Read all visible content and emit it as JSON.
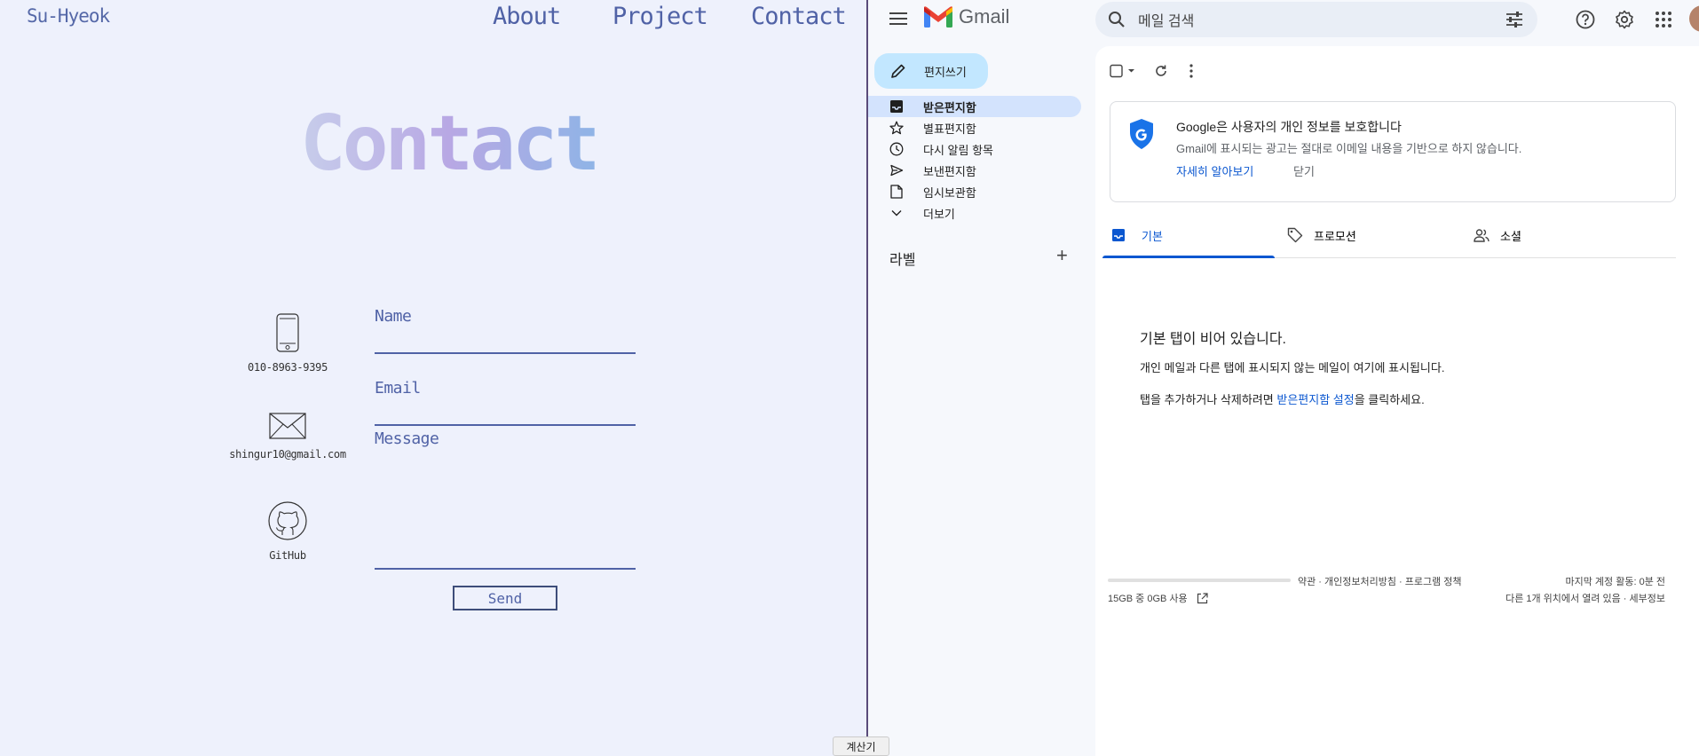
{
  "portfolio": {
    "brand": "Su-Hyeok",
    "nav": [
      "About",
      "Project",
      "Contact"
    ],
    "hero": "Contact",
    "contacts": [
      {
        "icon": "phone-icon",
        "caption": "010-8963-9395"
      },
      {
        "icon": "mail-icon",
        "caption": "shingur10@gmail.com"
      },
      {
        "icon": "github-icon",
        "caption": "GitHub"
      }
    ],
    "form": {
      "name_label": "Name",
      "email_label": "Email",
      "message_label": "Message",
      "send_label": "Send"
    },
    "taskbar_tip": "계산기"
  },
  "gmail": {
    "logo": "Gmail",
    "search_placeholder": "메일 검색",
    "compose": "편지쓰기",
    "nav": [
      {
        "label": "받은편지함",
        "icon": "inbox-icon",
        "active": true
      },
      {
        "label": "별표편지함",
        "icon": "star-icon",
        "active": false
      },
      {
        "label": "다시 알림 항목",
        "icon": "clock-icon",
        "active": false
      },
      {
        "label": "보낸편지함",
        "icon": "send-icon",
        "active": false
      },
      {
        "label": "임시보관함",
        "icon": "draft-icon",
        "active": false
      },
      {
        "label": "더보기",
        "icon": "chevron-down-icon",
        "active": false
      }
    ],
    "labels_heading": "라벨",
    "privacy": {
      "title": "Google은 사용자의 개인 정보를 보호합니다",
      "description": "Gmail에 표시되는 광고는 절대로 이메일 내용을 기반으로 하지 않습니다.",
      "learn_more": "자세히 알아보기",
      "dismiss": "닫기"
    },
    "tabs": [
      {
        "label": "기본",
        "icon": "inbox-icon",
        "active": true
      },
      {
        "label": "프로모션",
        "icon": "tag-icon",
        "active": false
      },
      {
        "label": "소셜",
        "icon": "people-icon",
        "active": false
      }
    ],
    "empty": {
      "title": "기본 탭이 비어 있습니다.",
      "description": "개인 메일과 다른 탭에 표시되지 않는 메일이 여기에 표시됩니다.",
      "hint_prefix": "탭을 추가하거나 삭제하려면 ",
      "hint_link": "받은편지함 설정",
      "hint_suffix": "을 클릭하세요."
    },
    "footer": {
      "storage": "15GB 중 0GB 사용",
      "storage_used_fraction": 0,
      "links": "약관 · 개인정보처리방침 · 프로그램 정책",
      "last_activity": "마지막 계정 활동: 0분 전",
      "open_locations": "다른 1개 위치에서 열려 있음 · 세부정보"
    }
  }
}
